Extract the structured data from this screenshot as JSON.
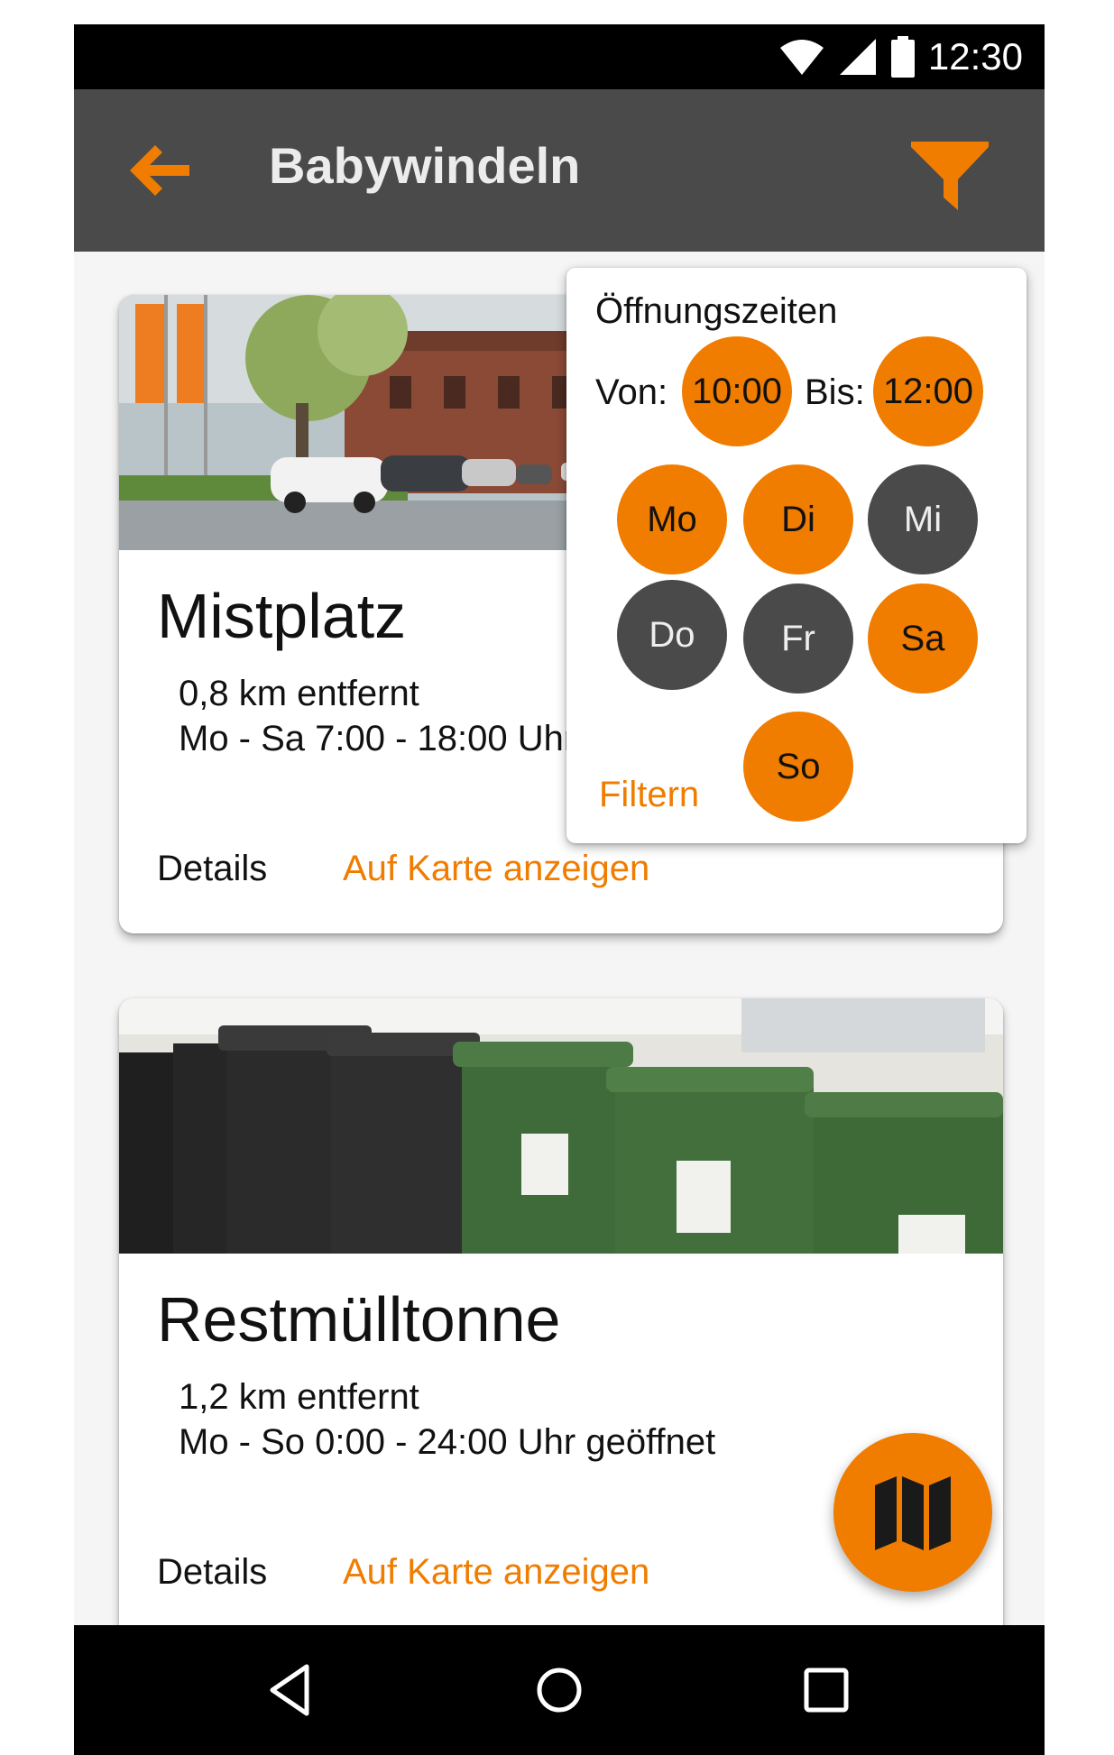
{
  "status_bar": {
    "time": "12:30"
  },
  "app_bar": {
    "title": "Babywindeln"
  },
  "cards": [
    {
      "title": "Mistplatz",
      "distance": "0,8 km entfernt",
      "hours": "Mo - Sa 7:00 - 18:00 Uhr",
      "details_label": "Details",
      "map_label": "Auf Karte anzeigen"
    },
    {
      "title": "Restmülltonne",
      "distance": "1,2 km entfernt",
      "hours": "Mo - So 0:00 - 24:00 Uhr geöffnet",
      "details_label": "Details",
      "map_label": "Auf Karte anzeigen"
    }
  ],
  "filter": {
    "title": "Öffnungszeiten",
    "from_label": "Von:",
    "from_value": "10:00",
    "to_label": "Bis:",
    "to_value": "12:00",
    "days": [
      {
        "label": "Mo",
        "selected": true
      },
      {
        "label": "Di",
        "selected": true
      },
      {
        "label": "Mi",
        "selected": false
      },
      {
        "label": "Do",
        "selected": false
      },
      {
        "label": "Fr",
        "selected": false
      },
      {
        "label": "Sa",
        "selected": true
      },
      {
        "label": "So",
        "selected": true
      }
    ],
    "apply_label": "Filtern"
  },
  "colors": {
    "accent": "#f07c00",
    "appbar": "#4a4a4a",
    "day_off": "#4a4a4a"
  },
  "icons": {
    "back": "arrow-left-icon",
    "filter": "funnel-icon",
    "fab": "map-icon",
    "nav": [
      "back-triangle-icon",
      "home-circle-icon",
      "recents-square-icon"
    ]
  }
}
